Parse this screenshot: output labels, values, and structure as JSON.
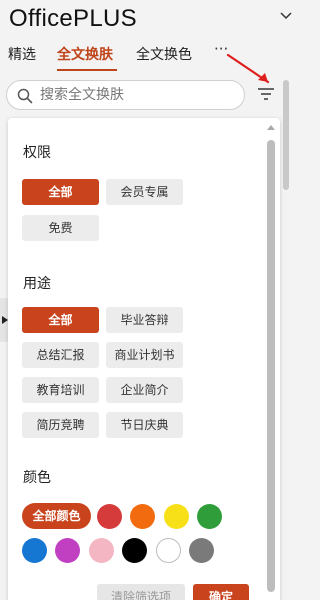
{
  "header": {
    "app_title": "OfficePLUS"
  },
  "tabs": [
    {
      "label": "精选",
      "active": false
    },
    {
      "label": "全文换肤",
      "active": true
    },
    {
      "label": "全文换色",
      "active": false
    }
  ],
  "more_tabs_label": "···",
  "search": {
    "placeholder": "搜索全文换肤",
    "value": ""
  },
  "filter": {
    "permission": {
      "title": "权限",
      "options": [
        {
          "label": "全部",
          "selected": true
        },
        {
          "label": "会员专属",
          "selected": false
        },
        {
          "label": "免费",
          "selected": false
        }
      ]
    },
    "usage": {
      "title": "用途",
      "options": [
        {
          "label": "全部",
          "selected": true
        },
        {
          "label": "毕业答辩",
          "selected": false
        },
        {
          "label": "总结汇报",
          "selected": false
        },
        {
          "label": "商业计划书",
          "selected": false
        },
        {
          "label": "教育培训",
          "selected": false
        },
        {
          "label": "企业简介",
          "selected": false
        },
        {
          "label": "简历竞聘",
          "selected": false
        },
        {
          "label": "节日庆典",
          "selected": false
        }
      ]
    },
    "color": {
      "title": "颜色",
      "all_label": "全部颜色",
      "swatches": [
        {
          "name": "red",
          "hex": "#d63b3b"
        },
        {
          "name": "orange",
          "hex": "#f26b0f"
        },
        {
          "name": "yellow",
          "hex": "#f7e017"
        },
        {
          "name": "green",
          "hex": "#2e9d3a"
        },
        {
          "name": "blue",
          "hex": "#1677d2"
        },
        {
          "name": "purple",
          "hex": "#c13fc1"
        },
        {
          "name": "pink",
          "hex": "#f5b6c4"
        },
        {
          "name": "black",
          "hex": "#000000"
        },
        {
          "name": "white",
          "hex": "#ffffff"
        },
        {
          "name": "gray",
          "hex": "#7a7a7a"
        }
      ]
    },
    "actions": {
      "clear_label": "清除筛选项",
      "confirm_label": "确定"
    }
  },
  "colors": {
    "accent": "#c9431c",
    "chip_bg": "#ececec"
  }
}
